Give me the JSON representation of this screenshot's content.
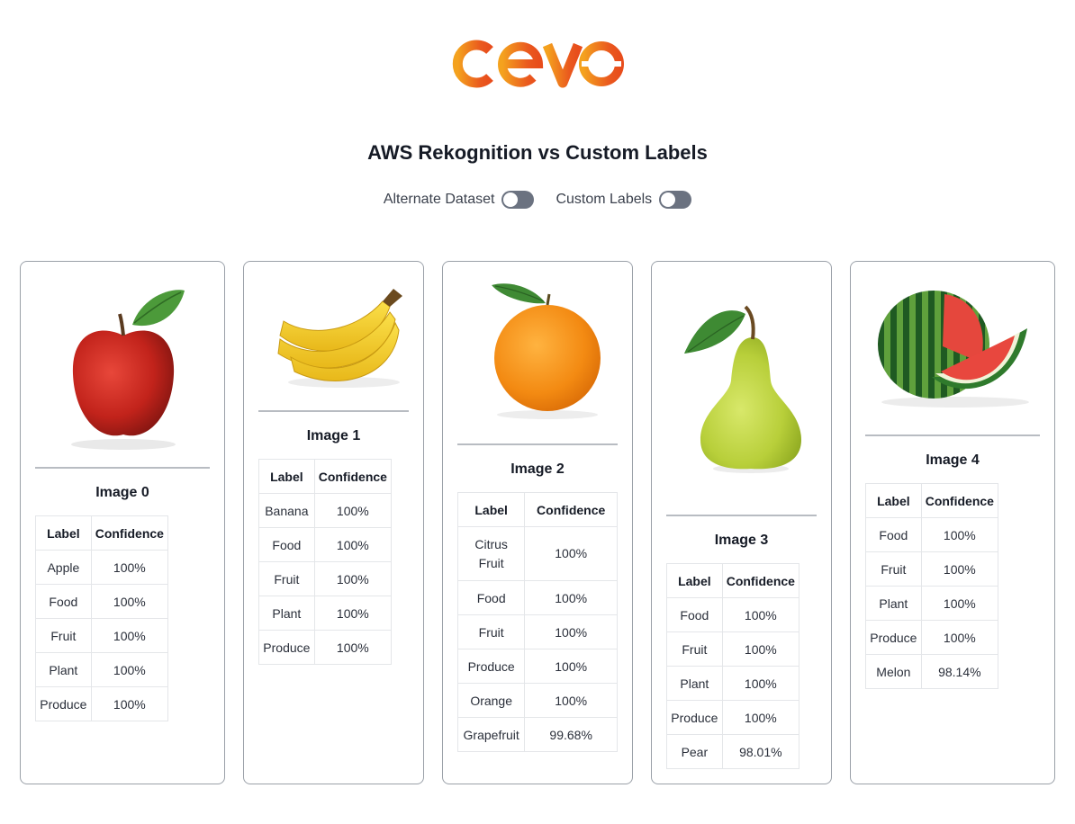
{
  "logo": {
    "text": "cevo",
    "colors": [
      "#f4a21e",
      "#ea5a1e"
    ]
  },
  "page_title": "AWS Rekognition vs Custom Labels",
  "toggles": [
    {
      "label": "Alternate Dataset",
      "on": false
    },
    {
      "label": "Custom Labels",
      "on": false
    }
  ],
  "table_headers": {
    "label": "Label",
    "confidence": "Confidence"
  },
  "cards": [
    {
      "title": "Image 0",
      "image_icon": "apple-image",
      "rows": [
        [
          "Apple",
          "100%"
        ],
        [
          "Food",
          "100%"
        ],
        [
          "Fruit",
          "100%"
        ],
        [
          "Plant",
          "100%"
        ],
        [
          "Produce",
          "100%"
        ]
      ]
    },
    {
      "title": "Image 1",
      "image_icon": "banana-image",
      "rows": [
        [
          "Banana",
          "100%"
        ],
        [
          "Food",
          "100%"
        ],
        [
          "Fruit",
          "100%"
        ],
        [
          "Plant",
          "100%"
        ],
        [
          "Produce",
          "100%"
        ]
      ]
    },
    {
      "title": "Image 2",
      "image_icon": "orange-image",
      "rows": [
        [
          "Citrus Fruit",
          "100%"
        ],
        [
          "Food",
          "100%"
        ],
        [
          "Fruit",
          "100%"
        ],
        [
          "Produce",
          "100%"
        ],
        [
          "Orange",
          "100%"
        ],
        [
          "Grapefruit",
          "99.68%"
        ]
      ]
    },
    {
      "title": "Image 3",
      "image_icon": "pear-image",
      "rows": [
        [
          "Food",
          "100%"
        ],
        [
          "Fruit",
          "100%"
        ],
        [
          "Plant",
          "100%"
        ],
        [
          "Produce",
          "100%"
        ],
        [
          "Pear",
          "98.01%"
        ]
      ]
    },
    {
      "title": "Image 4",
      "image_icon": "watermelon-image",
      "rows": [
        [
          "Food",
          "100%"
        ],
        [
          "Fruit",
          "100%"
        ],
        [
          "Plant",
          "100%"
        ],
        [
          "Produce",
          "100%"
        ],
        [
          "Melon",
          "98.14%"
        ]
      ]
    }
  ]
}
